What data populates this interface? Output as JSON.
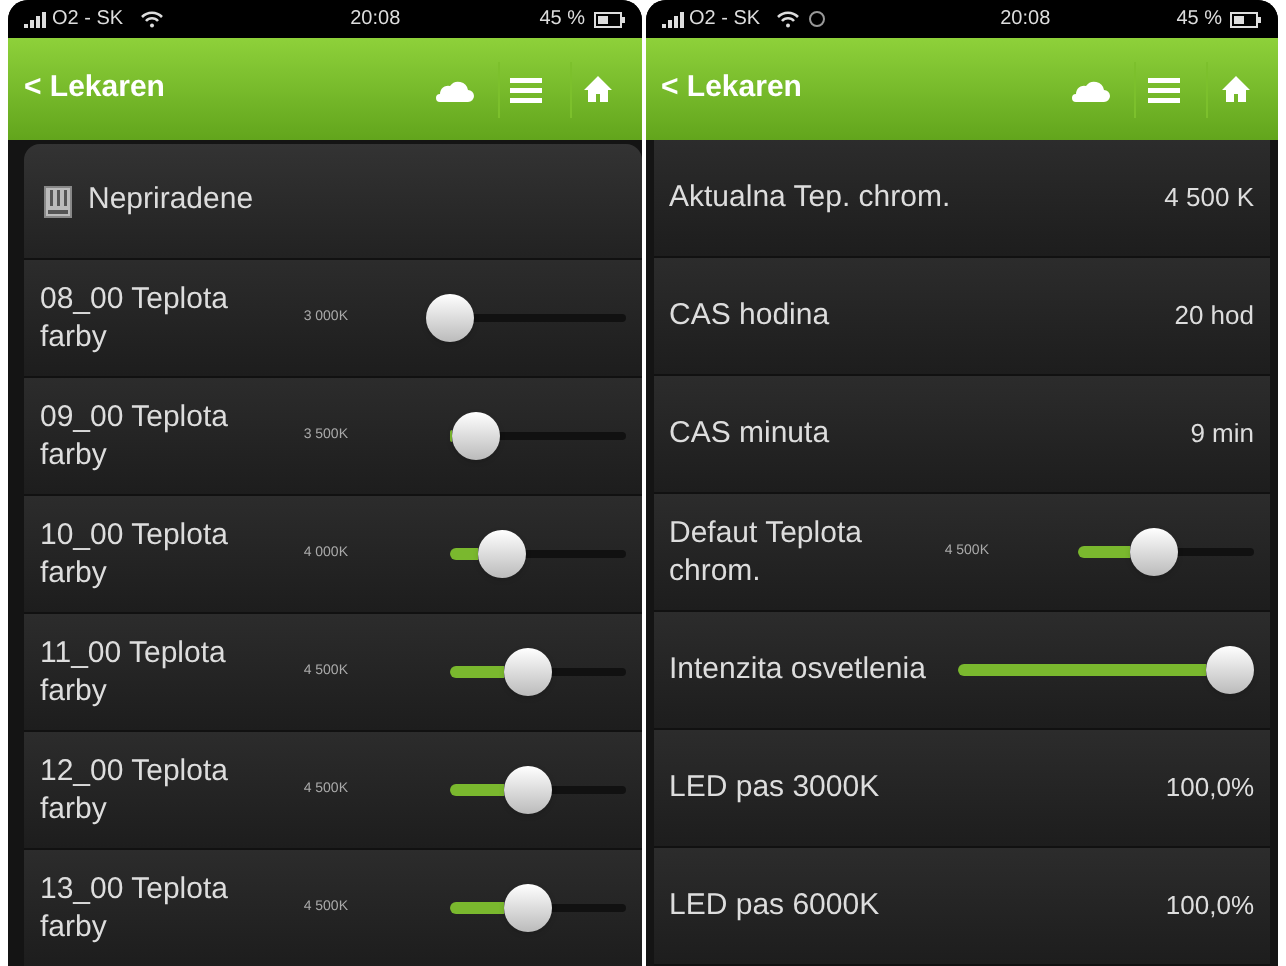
{
  "screens": [
    {
      "status_bar": {
        "carrier": "O2 - SK",
        "time": "20:08",
        "battery": "45 %",
        "alarm": false
      },
      "header": {
        "back": "< Lekaren"
      },
      "group": {
        "title": "Nepriradene"
      },
      "rows": [
        {
          "kind": "slider",
          "label": "08_00 Teplota farby",
          "reading": "3 000K",
          "level": 0
        },
        {
          "kind": "slider",
          "label": "09_00 Teplota farby",
          "reading": "3 500K",
          "level": 0.18
        },
        {
          "kind": "slider",
          "label": "10_00 Teplota farby",
          "reading": "4 000K",
          "level": 0.35
        },
        {
          "kind": "slider",
          "label": "11_00 Teplota farby",
          "reading": "4 500K",
          "level": 0.52
        },
        {
          "kind": "slider",
          "label": "12_00 Teplota farby",
          "reading": "4 500K",
          "level": 0.52
        },
        {
          "kind": "slider",
          "label": "13_00 Teplota farby",
          "reading": "4 500K",
          "level": 0.52
        }
      ]
    },
    {
      "status_bar": {
        "carrier": "O2 - SK",
        "time": "20:08",
        "battery": "45 %",
        "alarm": true
      },
      "header": {
        "back": "< Lekaren"
      },
      "rows": [
        {
          "kind": "value",
          "label": "Aktualna Tep. chrom.",
          "value": "4 500 K"
        },
        {
          "kind": "value",
          "label": "CAS hodina",
          "value": "20 hod"
        },
        {
          "kind": "value",
          "label": "CAS minuta",
          "value": "9 min"
        },
        {
          "kind": "slider",
          "label": "Defaut Teplota chrom.",
          "reading": "4 500K",
          "level": 0.5
        },
        {
          "kind": "wide_slider",
          "label": "Intenzita osvetlenia",
          "level": 1
        },
        {
          "kind": "value",
          "label": "LED pas 3000K",
          "value": "100,0%"
        },
        {
          "kind": "value",
          "label": "LED pas 6000K",
          "value": "100,0%"
        }
      ]
    }
  ]
}
